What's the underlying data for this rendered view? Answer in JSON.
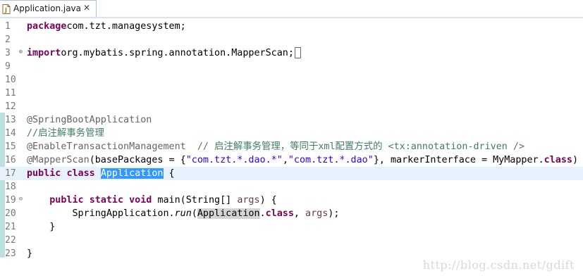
{
  "tab": {
    "title": "Application.java",
    "close": "✕",
    "icon": "java-file-icon"
  },
  "lines": [
    {
      "n": "1",
      "parts": [
        [
          "kw",
          "package"
        ],
        [
          "",
          "com.tzt.managesystem;"
        ]
      ]
    },
    {
      "n": "2",
      "parts": []
    },
    {
      "n": "3",
      "fold": "⊕",
      "parts": [
        [
          "kw",
          "import"
        ],
        [
          "",
          "org.mybatis.spring.annotation.MapperScan;"
        ]
      ],
      "box": true
    },
    {
      "n": "9",
      "parts": []
    },
    {
      "n": "10",
      "parts": []
    },
    {
      "n": "11",
      "parts": []
    },
    {
      "n": "12",
      "parts": []
    },
    {
      "n": "13",
      "parts": [
        [
          "ann",
          "@SpringBootApplication"
        ]
      ]
    },
    {
      "n": "14",
      "parts": [
        [
          "cmt",
          "//启注解事务管理"
        ]
      ]
    },
    {
      "n": "15",
      "parts": [
        [
          "ann",
          "@EnableTransactionManagement"
        ],
        [
          "",
          "  "
        ],
        [
          "cmt",
          "// 启注解事务管理，等同于xml配置方式的 <tx:annotation-driven />"
        ]
      ]
    },
    {
      "n": "16",
      "parts": [
        [
          "ann",
          "@MapperScan"
        ],
        [
          "",
          "(basePackages = {"
        ],
        [
          "str",
          "\"com.tzt.*.dao.*\""
        ],
        [
          "",
          ","
        ],
        [
          "str",
          "\"com.tzt.*.dao\""
        ],
        [
          "",
          "}, markerInterface = MyMapper."
        ],
        [
          "kw",
          "class"
        ],
        [
          "",
          ")"
        ]
      ]
    },
    {
      "n": "17",
      "current": true,
      "parts": [
        [
          "kw",
          "public"
        ],
        [
          "",
          " "
        ],
        [
          "kw",
          "class"
        ],
        [
          "",
          " "
        ],
        [
          "sel",
          "Application"
        ],
        [
          "",
          " {"
        ]
      ]
    },
    {
      "n": "18",
      "parts": []
    },
    {
      "n": "19",
      "fold": "⊖",
      "parts": [
        [
          "",
          "    "
        ],
        [
          "kw",
          "public"
        ],
        [
          "",
          " "
        ],
        [
          "kw",
          "static"
        ],
        [
          "",
          " "
        ],
        [
          "kw",
          "void"
        ],
        [
          "",
          " main(String[] "
        ],
        [
          "param",
          "args"
        ],
        [
          "",
          ") {"
        ]
      ]
    },
    {
      "n": "20",
      "parts": [
        [
          "",
          "        SpringApplication."
        ],
        [
          "it",
          "run"
        ],
        [
          "",
          "("
        ],
        [
          "hl",
          "Application"
        ],
        [
          "",
          "."
        ],
        [
          "kw",
          "class"
        ],
        [
          "",
          ", "
        ],
        [
          "param",
          "args"
        ],
        [
          "",
          ");"
        ]
      ]
    },
    {
      "n": "21",
      "parts": [
        [
          "",
          "    }"
        ]
      ]
    },
    {
      "n": "22",
      "parts": []
    },
    {
      "n": "23",
      "parts": [
        [
          "",
          "}"
        ]
      ]
    }
  ],
  "watermark": "http://blog.csdn.net/gdift",
  "colors": {
    "keyword": "#7f0055",
    "comment": "#3f7f5f",
    "string": "#2a00ff",
    "annotation": "#646464",
    "selection": "#3399ff"
  }
}
